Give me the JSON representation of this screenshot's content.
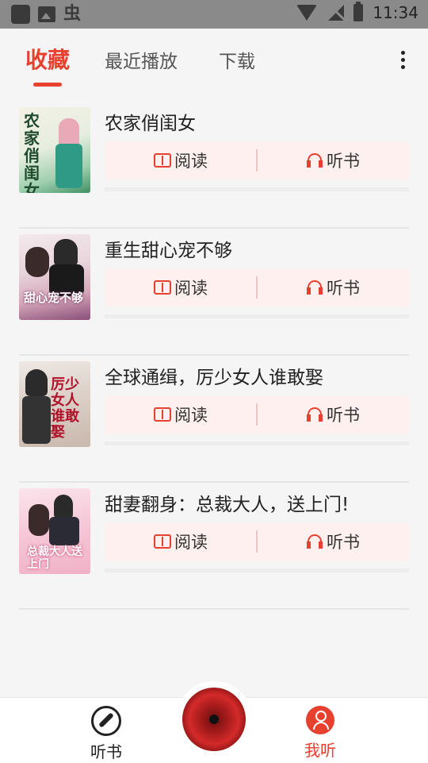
{
  "status_bar": {
    "time": "11:34"
  },
  "tabs": [
    {
      "label": "收藏",
      "active": true
    },
    {
      "label": "最近播放",
      "active": false
    },
    {
      "label": "下载",
      "active": false
    }
  ],
  "books": [
    {
      "title": "农家俏闺女",
      "read_label": "阅读",
      "listen_label": "听书",
      "cover_text": "农家俏闺女",
      "progress": 0
    },
    {
      "title": "重生甜心宠不够",
      "read_label": "阅读",
      "listen_label": "听书",
      "cover_text": "甜心宠不够",
      "progress": 0
    },
    {
      "title": "全球通缉，厉少女人谁敢娶",
      "read_label": "阅读",
      "listen_label": "听书",
      "cover_text": "厉少女人谁敢娶",
      "progress": 0
    },
    {
      "title": "甜妻翻身：总裁大人，送上门!",
      "read_label": "阅读",
      "listen_label": "听书",
      "cover_text": "总裁大人送上门",
      "progress": 0
    }
  ],
  "bottom_nav": {
    "listen_label": "听书",
    "mine_label": "我听"
  },
  "colors": {
    "accent": "#e8402f",
    "action_bg": "#fdf0ef"
  },
  "icons": [
    "book-icon",
    "headphones-icon",
    "compass-icon",
    "person-icon",
    "more-icon"
  ]
}
